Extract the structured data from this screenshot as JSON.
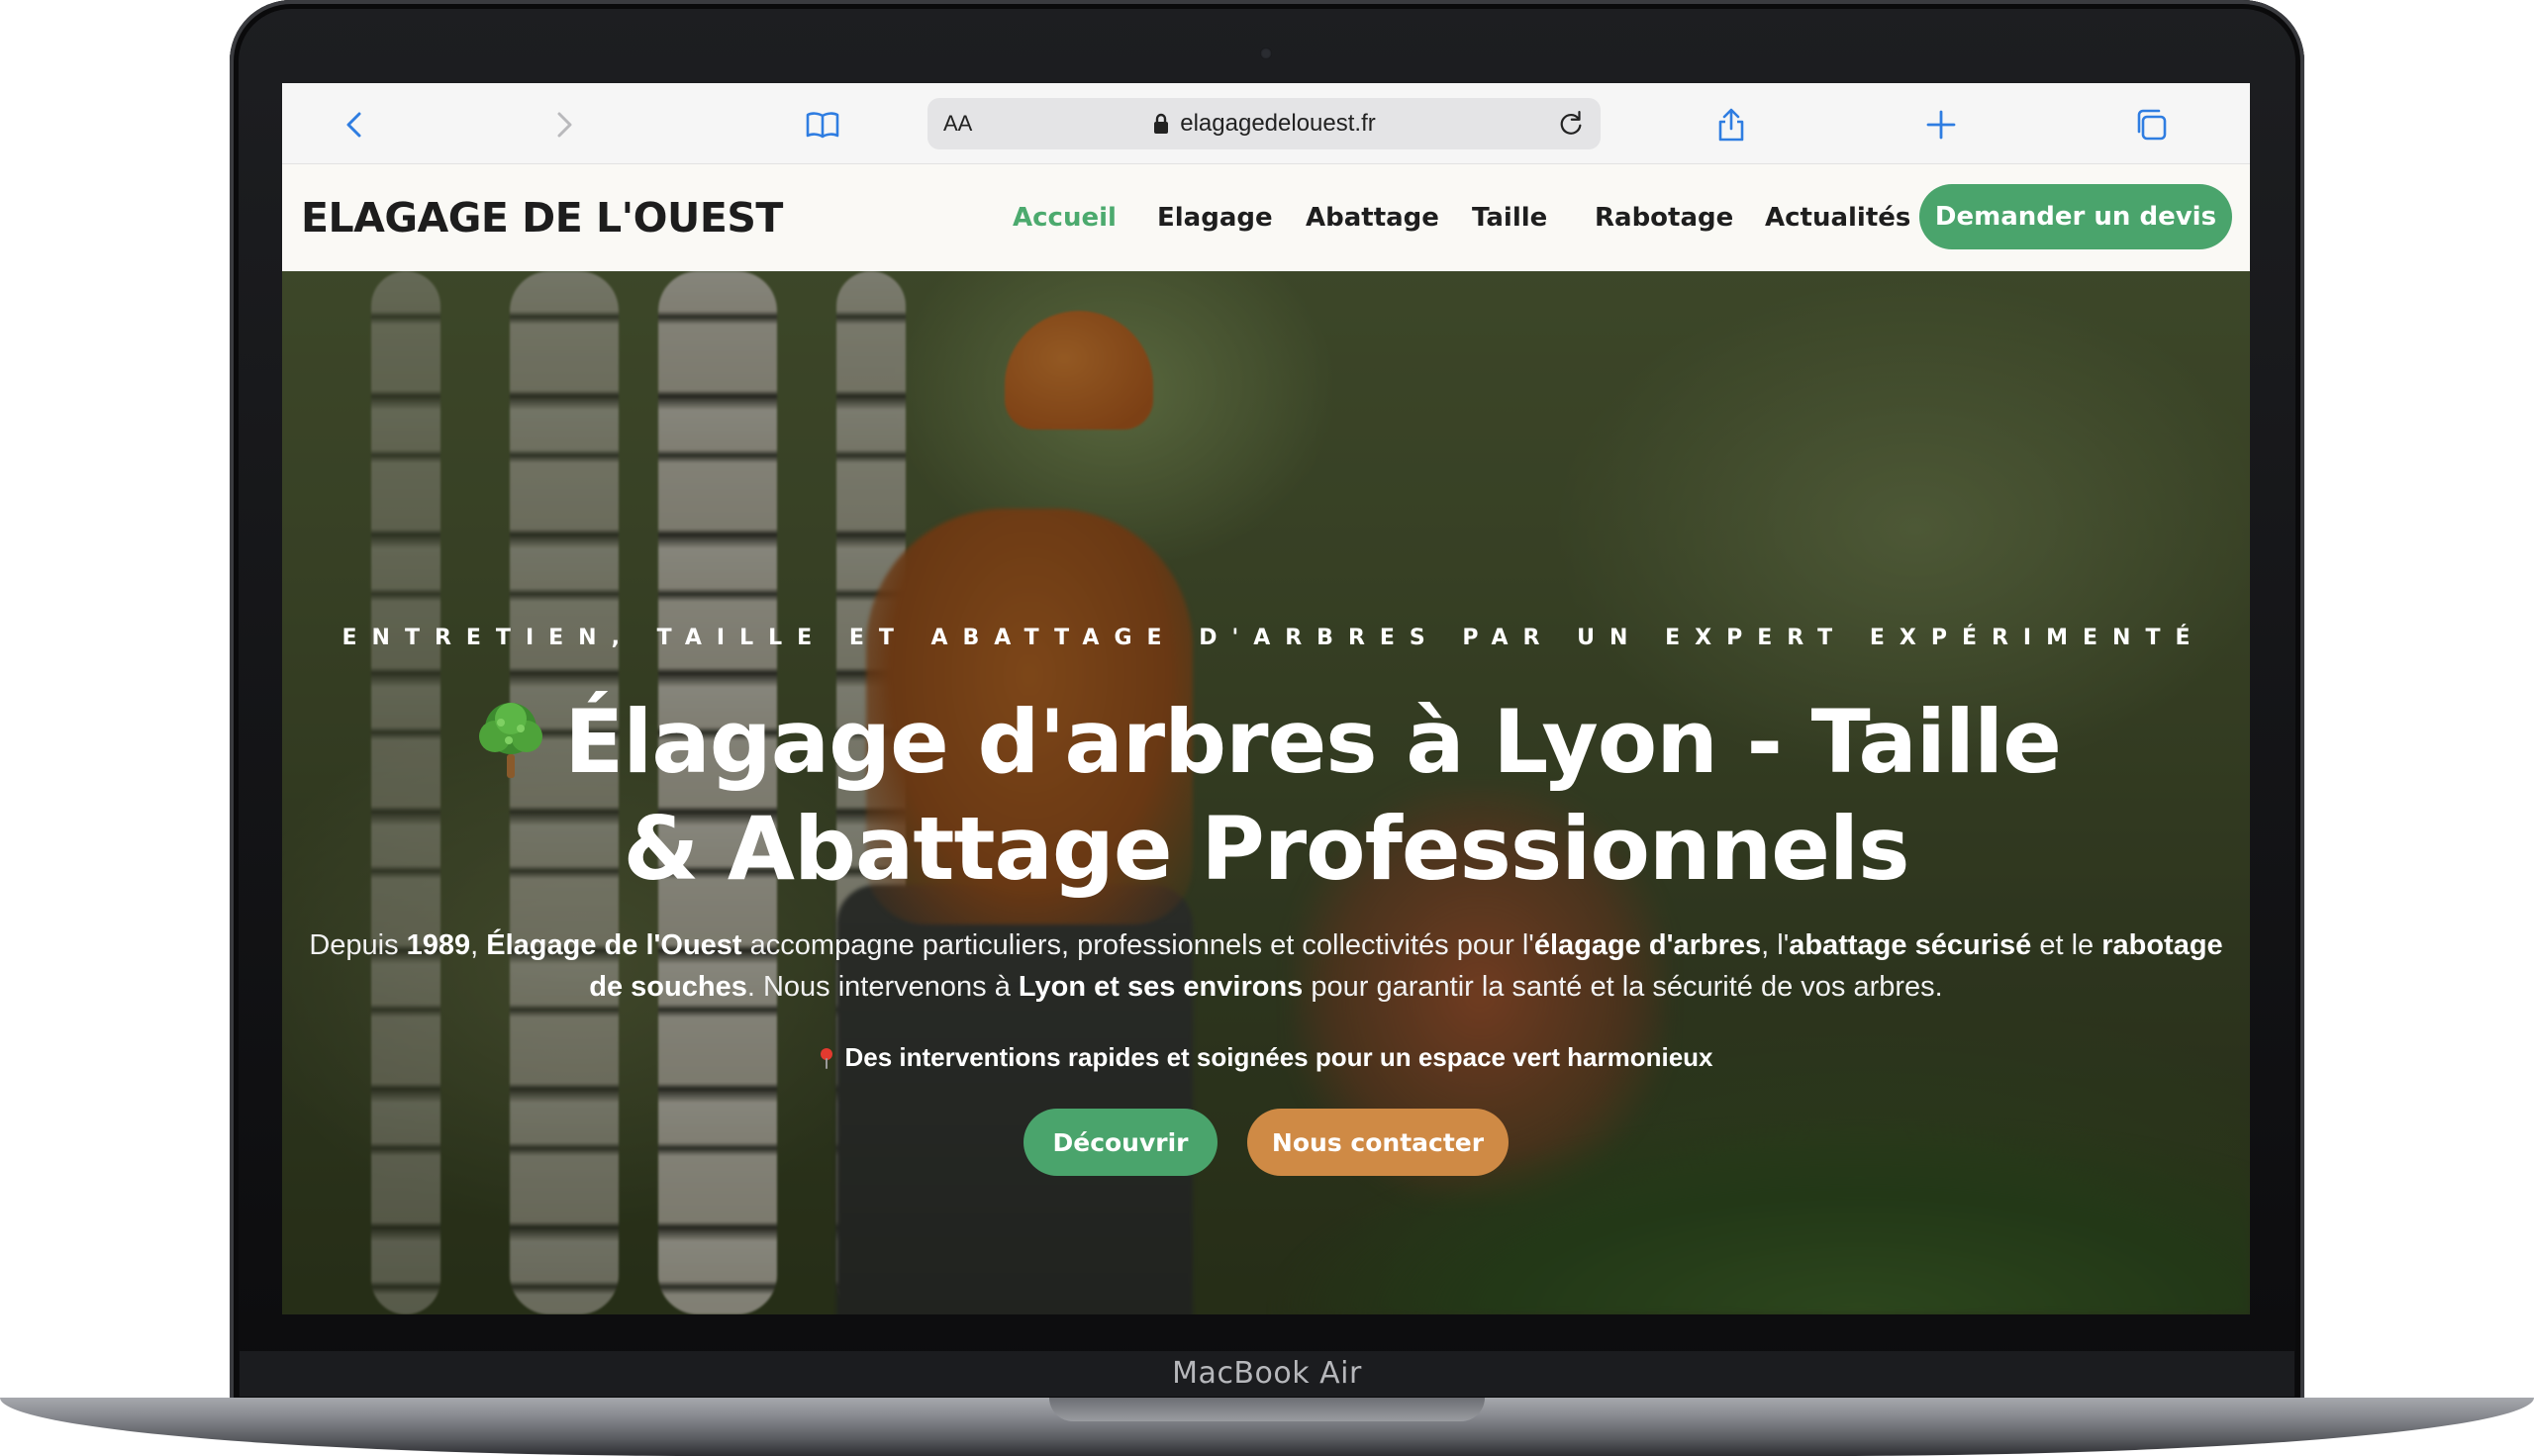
{
  "device": {
    "model_label": "MacBook Air"
  },
  "browser": {
    "reader_label": "AA",
    "url": "elagagedelouest.fr",
    "icons": {
      "back": "chevron-left-icon",
      "forward": "chevron-right-icon",
      "bookmarks": "book-icon",
      "lock": "lock-icon",
      "reload": "reload-icon",
      "share": "share-icon",
      "new_tab": "plus-icon",
      "tabs": "tabs-icon"
    },
    "accent_color": "#2f7de1"
  },
  "site": {
    "logo": "ELAGAGE DE L'OUEST",
    "nav": [
      {
        "label": "Accueil",
        "active": true
      },
      {
        "label": "Elagage",
        "active": false
      },
      {
        "label": "Abattage",
        "active": false
      },
      {
        "label": "Taille",
        "active": false
      },
      {
        "label": "Rabotage",
        "active": false
      },
      {
        "label": "Actualités",
        "active": false
      }
    ],
    "cta_label": "Demander un devis",
    "colors": {
      "green": "#4aa46c",
      "orange": "#cf8a45",
      "nav_active": "#4caa6e"
    }
  },
  "hero": {
    "kicker": "ENTRETIEN, TAILLE ET ABATTAGE D'ARBRES PAR UN EXPERT EXPÉRIMENTÉ",
    "title": "Élagage d'arbres à Lyon - Taille & Abattage Professionnels",
    "title_icon": "tree-icon",
    "desc": {
      "p1": "Depuis ",
      "b1": "1989",
      "p2": ", ",
      "b2": "Élagage de l'Ouest",
      "p3": " accompagne particuliers, professionnels et collectivités pour l'",
      "b3": "élagage d'arbres",
      "p4": ", l'",
      "b4": "abattage sécurisé",
      "p5": " et le ",
      "b5": "rabotage de souches",
      "p6": ". Nous intervenons à ",
      "b6": "Lyon et ses environs",
      "p7": " pour garantir la santé et la sécurité de vos arbres."
    },
    "tagline": "Des interventions rapides et soignées pour un espace vert harmonieux",
    "tagline_icon": "pin-icon",
    "btn_primary": "Découvrir",
    "btn_secondary": "Nous contacter"
  }
}
